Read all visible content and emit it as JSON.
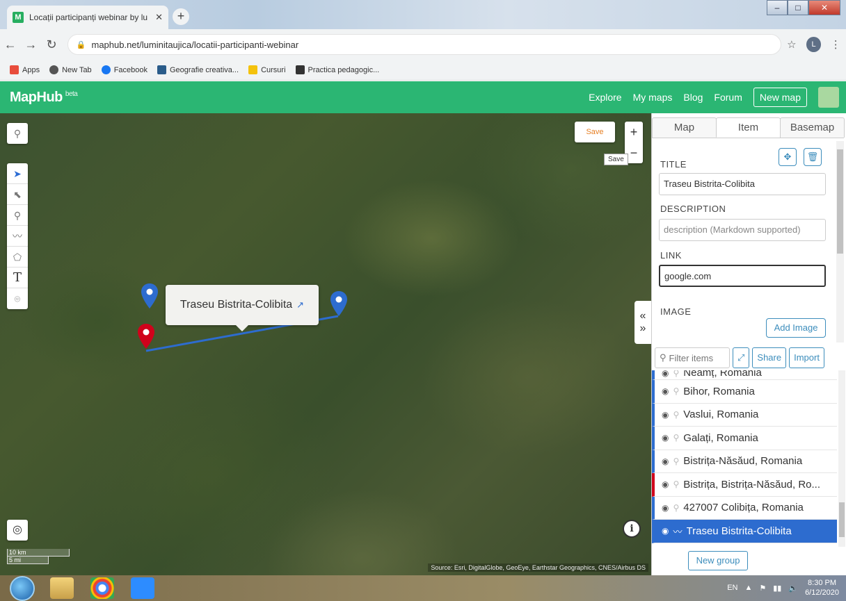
{
  "browser": {
    "tab_title": "Locații participanți webinar by lu",
    "tab_favicon": "M",
    "url": "maphub.net/luminitaujica/locatii-participanti-webinar",
    "bookmarks": [
      "Apps",
      "New Tab",
      "Facebook",
      "Geografie creativa...",
      "Cursuri",
      "Practica pedagogic..."
    ],
    "profile_initial": "L"
  },
  "header": {
    "logo": "MapHub",
    "logo_badge": "beta",
    "nav": [
      "Explore",
      "My maps",
      "Blog",
      "Forum"
    ],
    "new_map": "New map"
  },
  "map": {
    "save_label": "Save",
    "save_tooltip": "Save",
    "zoom_in": "+",
    "zoom_out": "−",
    "popup_title": "Traseu Bistrita-Colibita",
    "scale_km": "10 km",
    "scale_mi": "5 mi",
    "attribution": "Source: Esri, DigitalGlobe, GeoEye, Earthstar Geographics, CNES/Airbus DS",
    "route_color": "#2d6ccf",
    "marker_blue": "#2d6ccf",
    "marker_red": "#d0021b"
  },
  "panel": {
    "tabs": [
      "Map",
      "Item",
      "Basemap"
    ],
    "active_tab": "Item",
    "title_label": "TITLE",
    "title_value": "Traseu Bistrita-Colibita",
    "description_label": "DESCRIPTION",
    "description_placeholder": "description (Markdown supported)",
    "link_label": "LINK",
    "link_value": "google.com",
    "image_label": "IMAGE",
    "add_image": "Add Image",
    "filter_placeholder": "Filter items",
    "share": "Share",
    "import": "Import",
    "items": [
      "Neamț, Romania",
      "Bihor, Romania",
      "Vaslui, Romania",
      "Galați, Romania",
      "Bistrița-Năsăud, Romania",
      "Bistrița, Bistrița-Năsăud, Ro...",
      "427007 Colibița, Romania",
      "Traseu Bistrita-Colibita"
    ],
    "new_group": "New group"
  },
  "taskbar": {
    "lang": "EN",
    "time": "8:30 PM",
    "date": "6/12/2020"
  }
}
